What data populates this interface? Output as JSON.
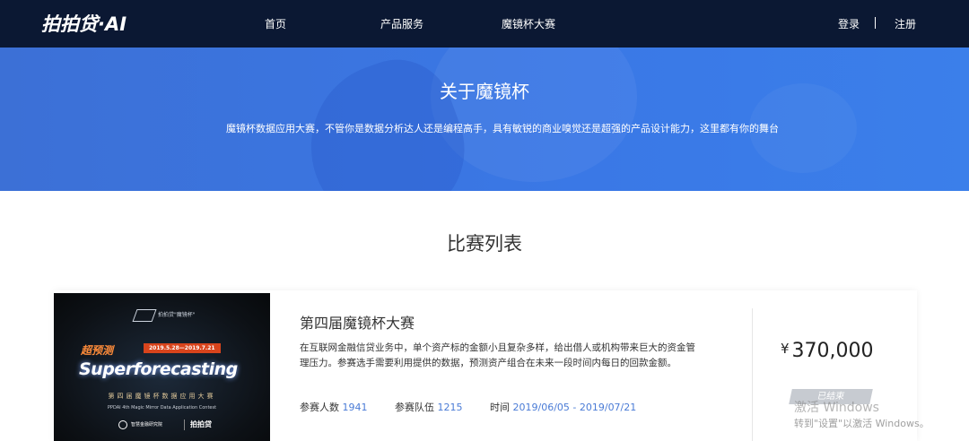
{
  "nav": {
    "logo": "拍拍贷·AI",
    "home": "首页",
    "products": "产品服务",
    "contest": "魔镜杯大赛",
    "login": "登录",
    "separator": "|",
    "register": "注册"
  },
  "hero": {
    "title": "关于魔镜杯",
    "description": "魔镜杯数据应用大赛，不管你是数据分析达人还是编程高手，具有敏锐的商业嗅觉还是超强的产品设计能力，这里都有你的舞台"
  },
  "section": {
    "title": "比赛列表"
  },
  "competitions": [
    {
      "poster": {
        "logo_text": "拍拍贷\"魔镜杯\"",
        "tag": "超预测",
        "date": "2019.5.28—2019.7.21",
        "main": "Superforecasting",
        "sub": "第四届魔镜杯数据应用大赛",
        "en": "PPDAI 4th Magic Mirror Data Application Contest",
        "sponsor1": "智慧金融研究院",
        "sponsor2": "拍拍贷"
      },
      "title": "第四届魔镜杯大赛",
      "description": "在互联网金融信贷业务中，单个资产标的金额小且复杂多样，给出借人或机构带来巨大的资金管理压力。参赛选手需要利用提供的数据，预测资产组合在未来一段时间内每日的回款金额。",
      "participants_label": "参赛人数",
      "participants": "1941",
      "teams_label": "参赛队伍",
      "teams": "1215",
      "time_label": "时间",
      "time": "2019/06/05 - 2019/07/21",
      "prize_currency": "¥",
      "prize": "370,000",
      "status": "已结束"
    }
  ],
  "watermark": {
    "line1": "激活 Windows",
    "line2": "转到\"设置\"以激活 Windows。"
  },
  "colors": {
    "topbar": "#0b1833",
    "hero": "#3a78e6",
    "link_value": "#4a7bd6",
    "status_badge": "#c7cbd1"
  }
}
